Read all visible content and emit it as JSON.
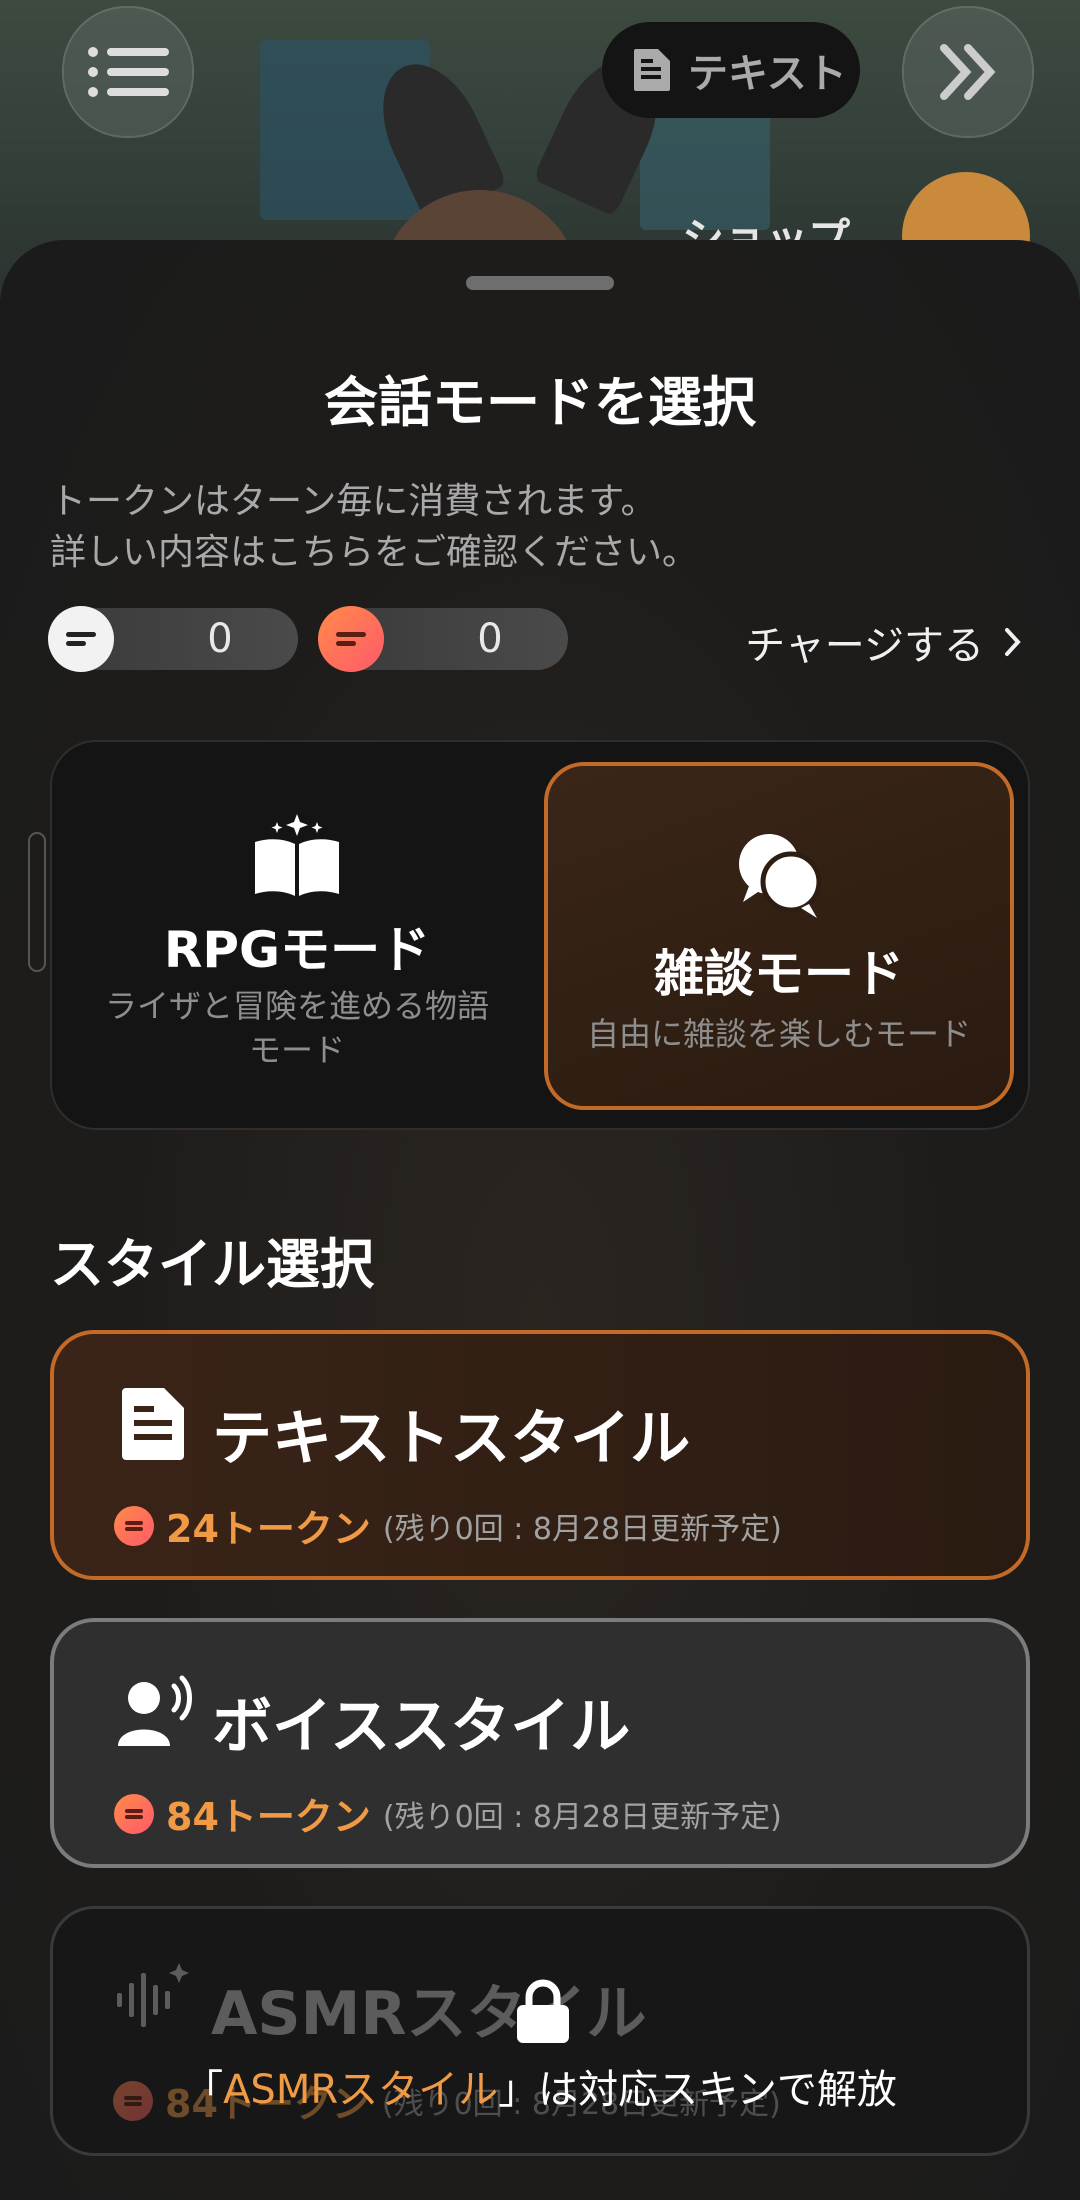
{
  "topbar": {
    "text_mode_label": "テキスト",
    "shop_label": "ショップ"
  },
  "sheet": {
    "title": "会話モードを選択",
    "description_line1": "トークンはターン毎に消費されます。",
    "description_line2": "詳しい内容はこちらをご確認ください。",
    "tokens": {
      "free_count": "0",
      "paid_count": "0"
    },
    "charge_label": "チャージする",
    "modes": [
      {
        "name": "RPGモード",
        "subtitle_line1": "ライザと冒険を進める物語",
        "subtitle_line2": "モード",
        "selected": false
      },
      {
        "name": "雑談モード",
        "subtitle_line1": "自由に雑談を楽しむモード",
        "selected": true
      }
    ],
    "style_section_title": "スタイル選択",
    "styles": [
      {
        "name": "テキストスタイル",
        "cost": "24トークン",
        "note": "(残り0回 : 8月28日更新予定)",
        "selected": true
      },
      {
        "name": "ボイススタイル",
        "cost": "84トークン",
        "note": "(残り0回 : 8月28日更新予定)",
        "selected": false
      },
      {
        "name": "ASMRスタイル",
        "cost": "84トークン",
        "note": "(残り0回 : 8月28日更新予定)",
        "locked": true,
        "lock_message_prefix": "「",
        "lock_message_highlight": "ASMRスタイル",
        "lock_message_suffix": "」は対応スキンで解放"
      }
    ]
  },
  "colors": {
    "accent_orange": "#c46a28",
    "token_orange": "#f09a45"
  }
}
